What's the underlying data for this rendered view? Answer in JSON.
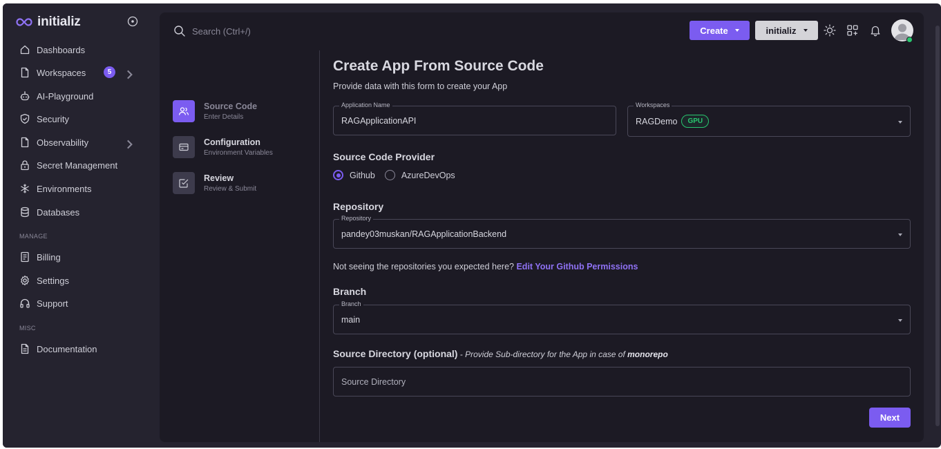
{
  "brand": {
    "name": "initializ",
    "accent": "#7b5cf0"
  },
  "sidebar": {
    "items": [
      {
        "label": "Dashboards",
        "icon": "home-icon"
      },
      {
        "label": "Workspaces",
        "icon": "file-icon",
        "badge": "5"
      },
      {
        "label": "AI-Playground",
        "icon": "robot-icon"
      },
      {
        "label": "Security",
        "icon": "shield-icon"
      },
      {
        "label": "Observability",
        "icon": "file-icon"
      },
      {
        "label": "Secret Management",
        "icon": "lock-icon"
      },
      {
        "label": "Environments",
        "icon": "snowflake-icon"
      },
      {
        "label": "Databases",
        "icon": "database-icon"
      }
    ],
    "manage_label": "MANAGE",
    "manage_items": [
      {
        "label": "Billing",
        "icon": "receipt-icon"
      },
      {
        "label": "Settings",
        "icon": "gear-icon"
      },
      {
        "label": "Support",
        "icon": "headphones-icon"
      }
    ],
    "misc_label": "MISC",
    "misc_items": [
      {
        "label": "Documentation",
        "icon": "document-icon"
      }
    ]
  },
  "topbar": {
    "search_placeholder": "Search (Ctrl+/)",
    "create_label": "Create",
    "org_label": "initializ"
  },
  "stepper": {
    "steps": [
      {
        "title": "Source Code",
        "subtitle": "Enter Details",
        "active": true
      },
      {
        "title": "Configuration",
        "subtitle": "Environment Variables",
        "active": false
      },
      {
        "title": "Review",
        "subtitle": "Review & Submit",
        "active": false
      }
    ]
  },
  "form": {
    "title": "Create App From Source Code",
    "description": "Provide data with this form to create your App",
    "app_name": {
      "label": "Application Name",
      "value": "RAGApplicationAPI"
    },
    "workspace": {
      "label": "Workspaces",
      "value": "RAGDemo",
      "badge": "GPU"
    },
    "provider": {
      "title": "Source Code Provider",
      "options": [
        "Github",
        "AzureDevOps"
      ],
      "selected": "Github"
    },
    "repository": {
      "title": "Repository",
      "label": "Repository",
      "value": "pandey03muskan/RAGApplicationBackend"
    },
    "help": {
      "text": "Not seeing the repositories you expected here?",
      "link": "Edit Your Github Permissions"
    },
    "branch": {
      "title": "Branch",
      "label": "Branch",
      "value": "main"
    },
    "source_dir": {
      "title": "Source Directory (optional)",
      "hint_prefix": " - Provide Sub-directory for the App in case of ",
      "hint_bold": "monorepo",
      "placeholder": "Source Directory"
    },
    "next_label": "Next"
  }
}
